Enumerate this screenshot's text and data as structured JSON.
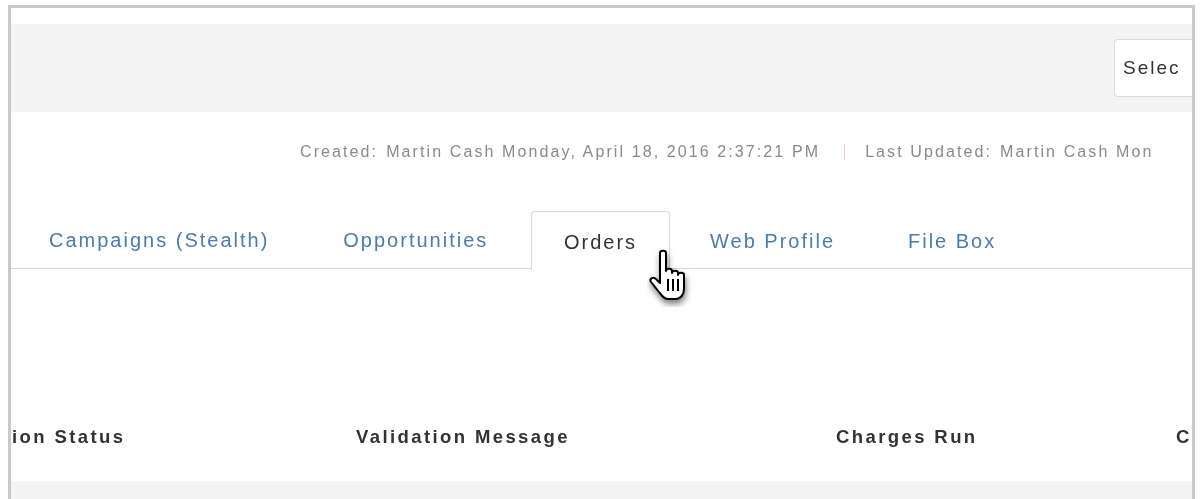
{
  "toolbar": {
    "select": {
      "value": "Selec"
    }
  },
  "audit": [
    {
      "label": "Created:",
      "value": "Martin Cash Monday, April 18, 2016 2:37:21 PM"
    },
    {
      "label": "Last Updated:",
      "value": "Martin Cash Mon"
    }
  ],
  "tabs": [
    {
      "label": "Campaigns (Stealth)",
      "selected": false
    },
    {
      "label": "Opportunities",
      "selected": false
    },
    {
      "label": "Orders",
      "selected": true
    },
    {
      "label": "Web Profile",
      "selected": false
    },
    {
      "label": "File Box",
      "selected": false
    }
  ],
  "table": {
    "columns": [
      "ion Status",
      "Validation Message",
      "Charges Run",
      "C"
    ]
  }
}
